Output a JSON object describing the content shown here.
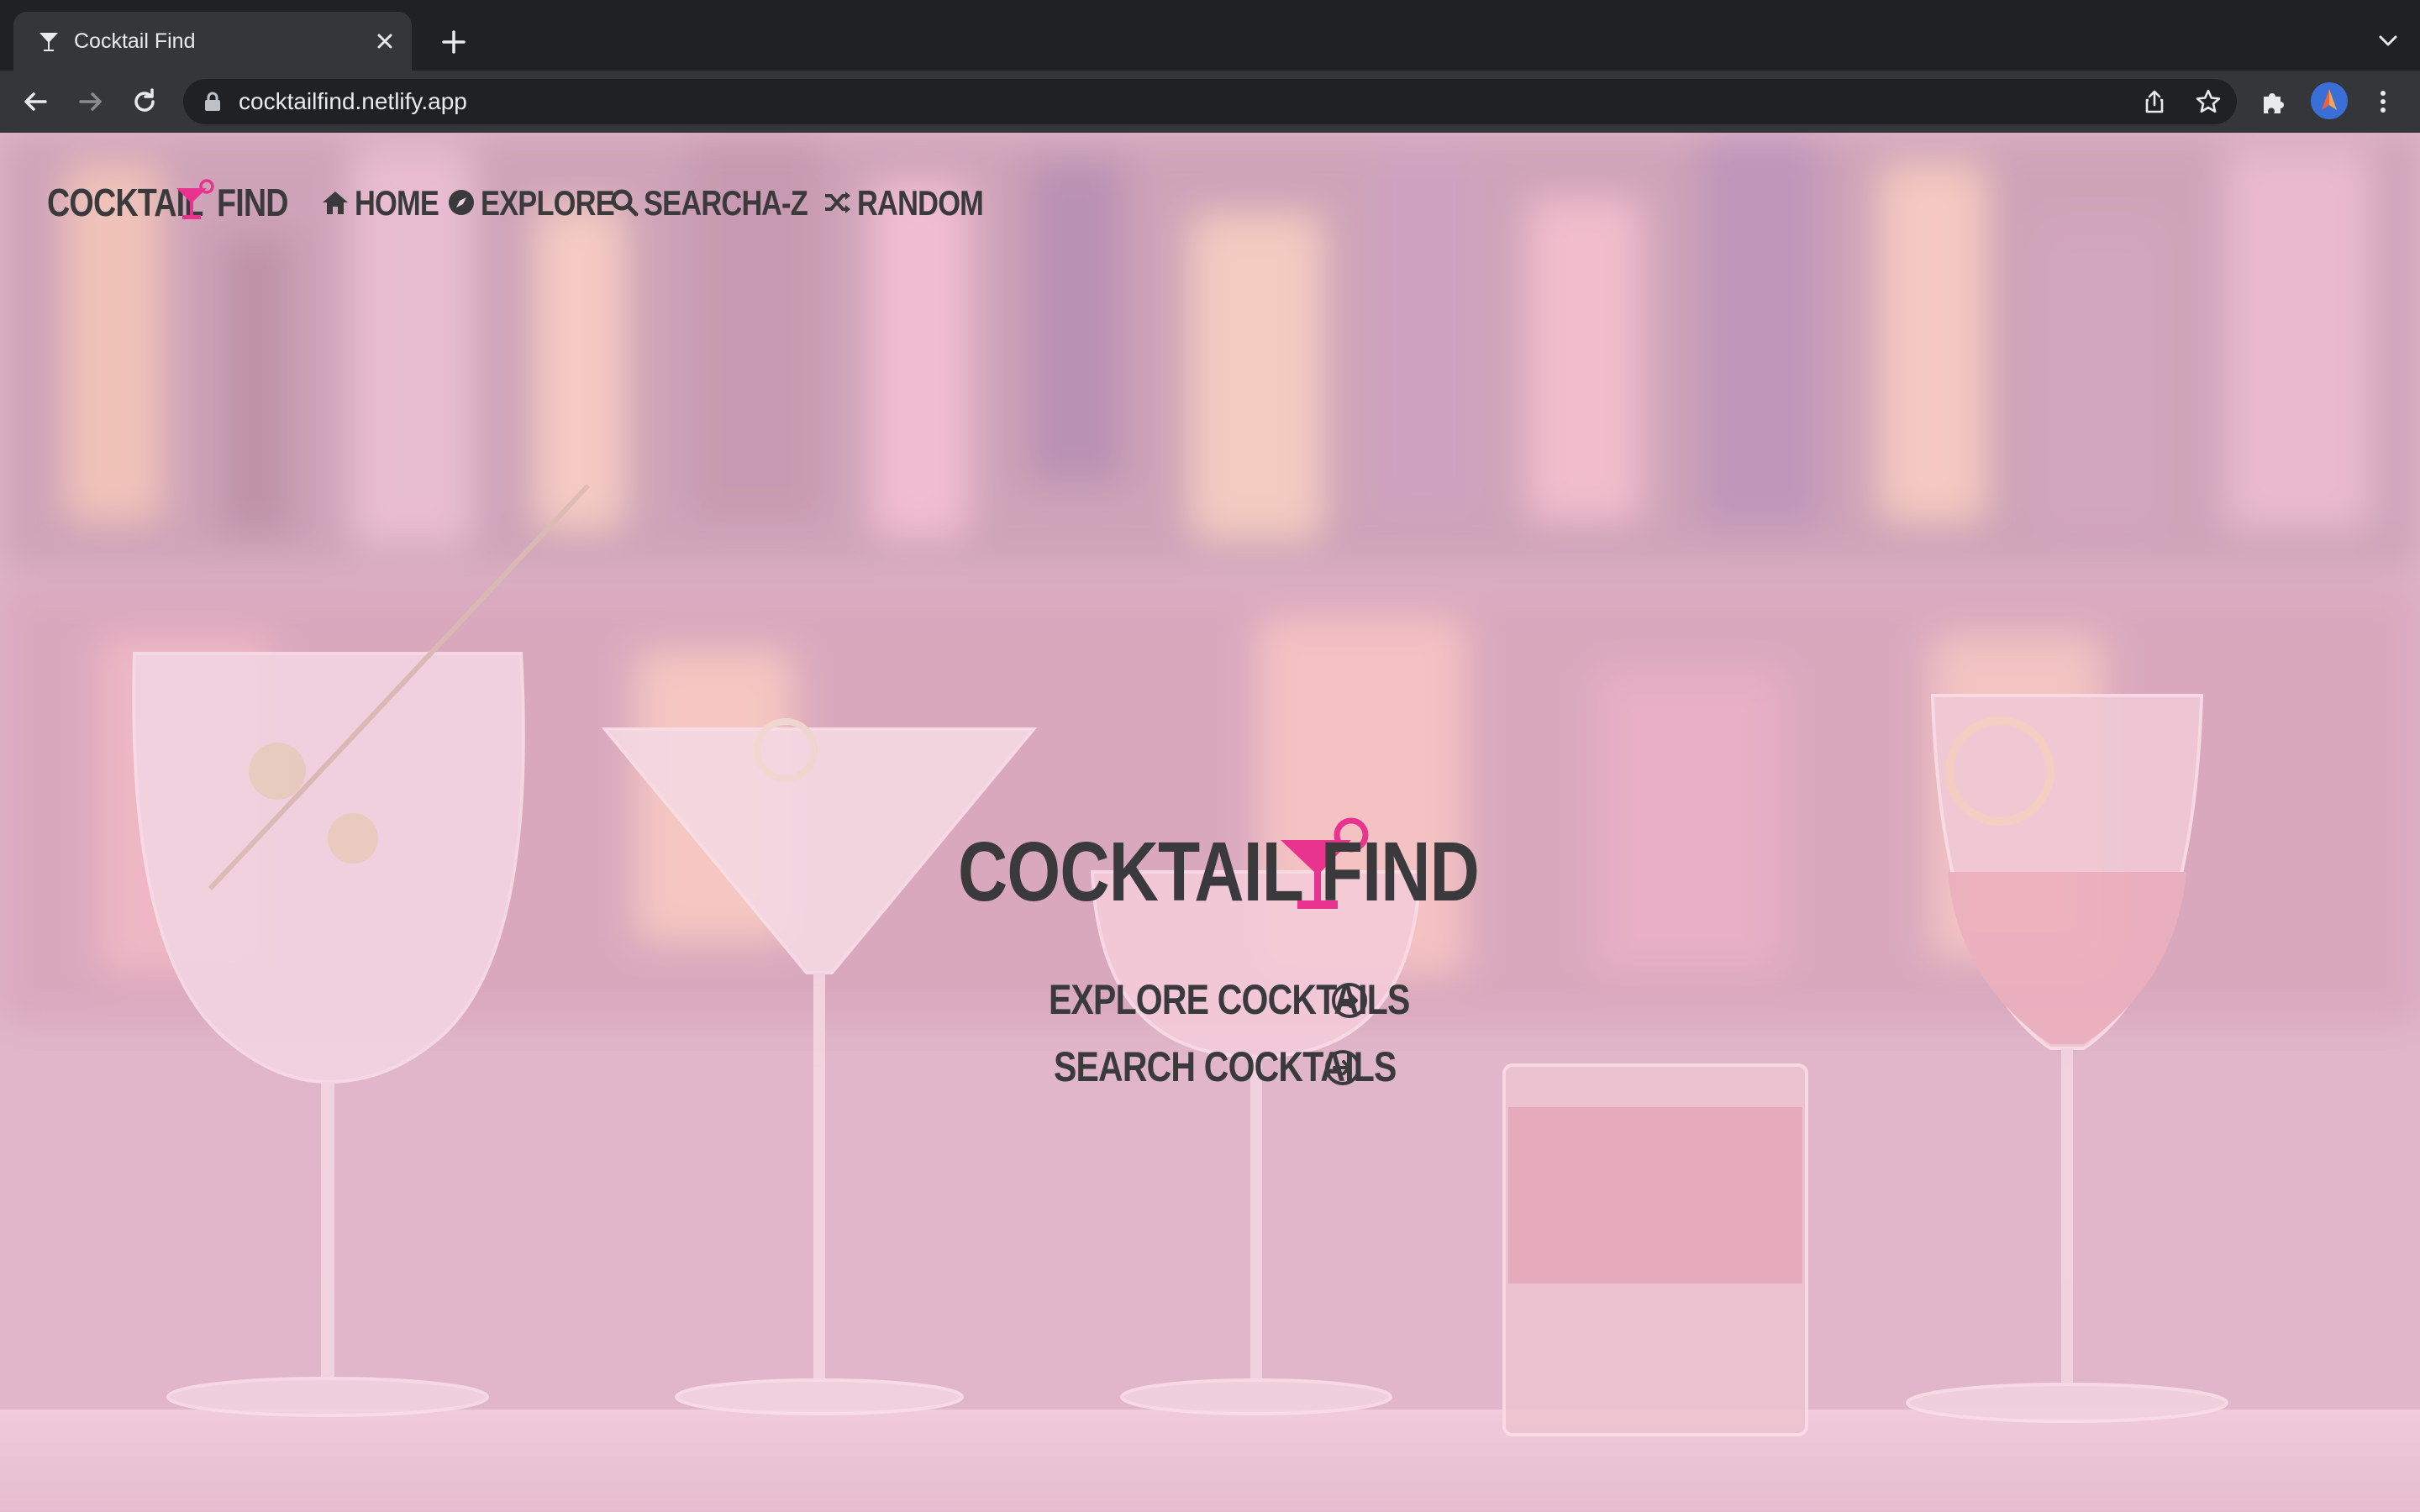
{
  "browser": {
    "tab_title": "Cocktail Find",
    "url": "cocktailfind.netlify.app",
    "icons": [
      "cocktail-favicon",
      "close-icon",
      "plus-icon",
      "chevron-down-icon",
      "back-arrow-icon",
      "forward-arrow-icon",
      "reload-icon",
      "lock-icon",
      "share-icon",
      "star-icon",
      "puzzle-icon",
      "avatar",
      "kebab-menu-icon"
    ]
  },
  "header": {
    "logo_left": "COCKTAIL",
    "logo_right": "FIND",
    "nav": [
      {
        "label": "HOME",
        "icon": "home-icon"
      },
      {
        "label": "EXPLORE",
        "icon": "compass-icon"
      },
      {
        "label": "SEARCH",
        "icon": "search-icon"
      },
      {
        "label": "A-Z",
        "icon": ""
      },
      {
        "label": "RANDOM",
        "icon": "shuffle-icon"
      }
    ]
  },
  "hero": {
    "logo_left": "COCKTAIL",
    "logo_right": "FIND",
    "buttons": [
      {
        "label": "EXPLORE COCKTAILS",
        "icon": "arrow-circle-right-icon"
      },
      {
        "label": "SEARCH COCKTAILS",
        "icon": "arrow-circle-right-icon"
      }
    ]
  },
  "colors": {
    "accent": "#e8348f",
    "text": "#3a3a3c",
    "overlay": "#f7cddd",
    "chrome_dark": "#202124",
    "chrome_toolbar": "#35363a"
  }
}
